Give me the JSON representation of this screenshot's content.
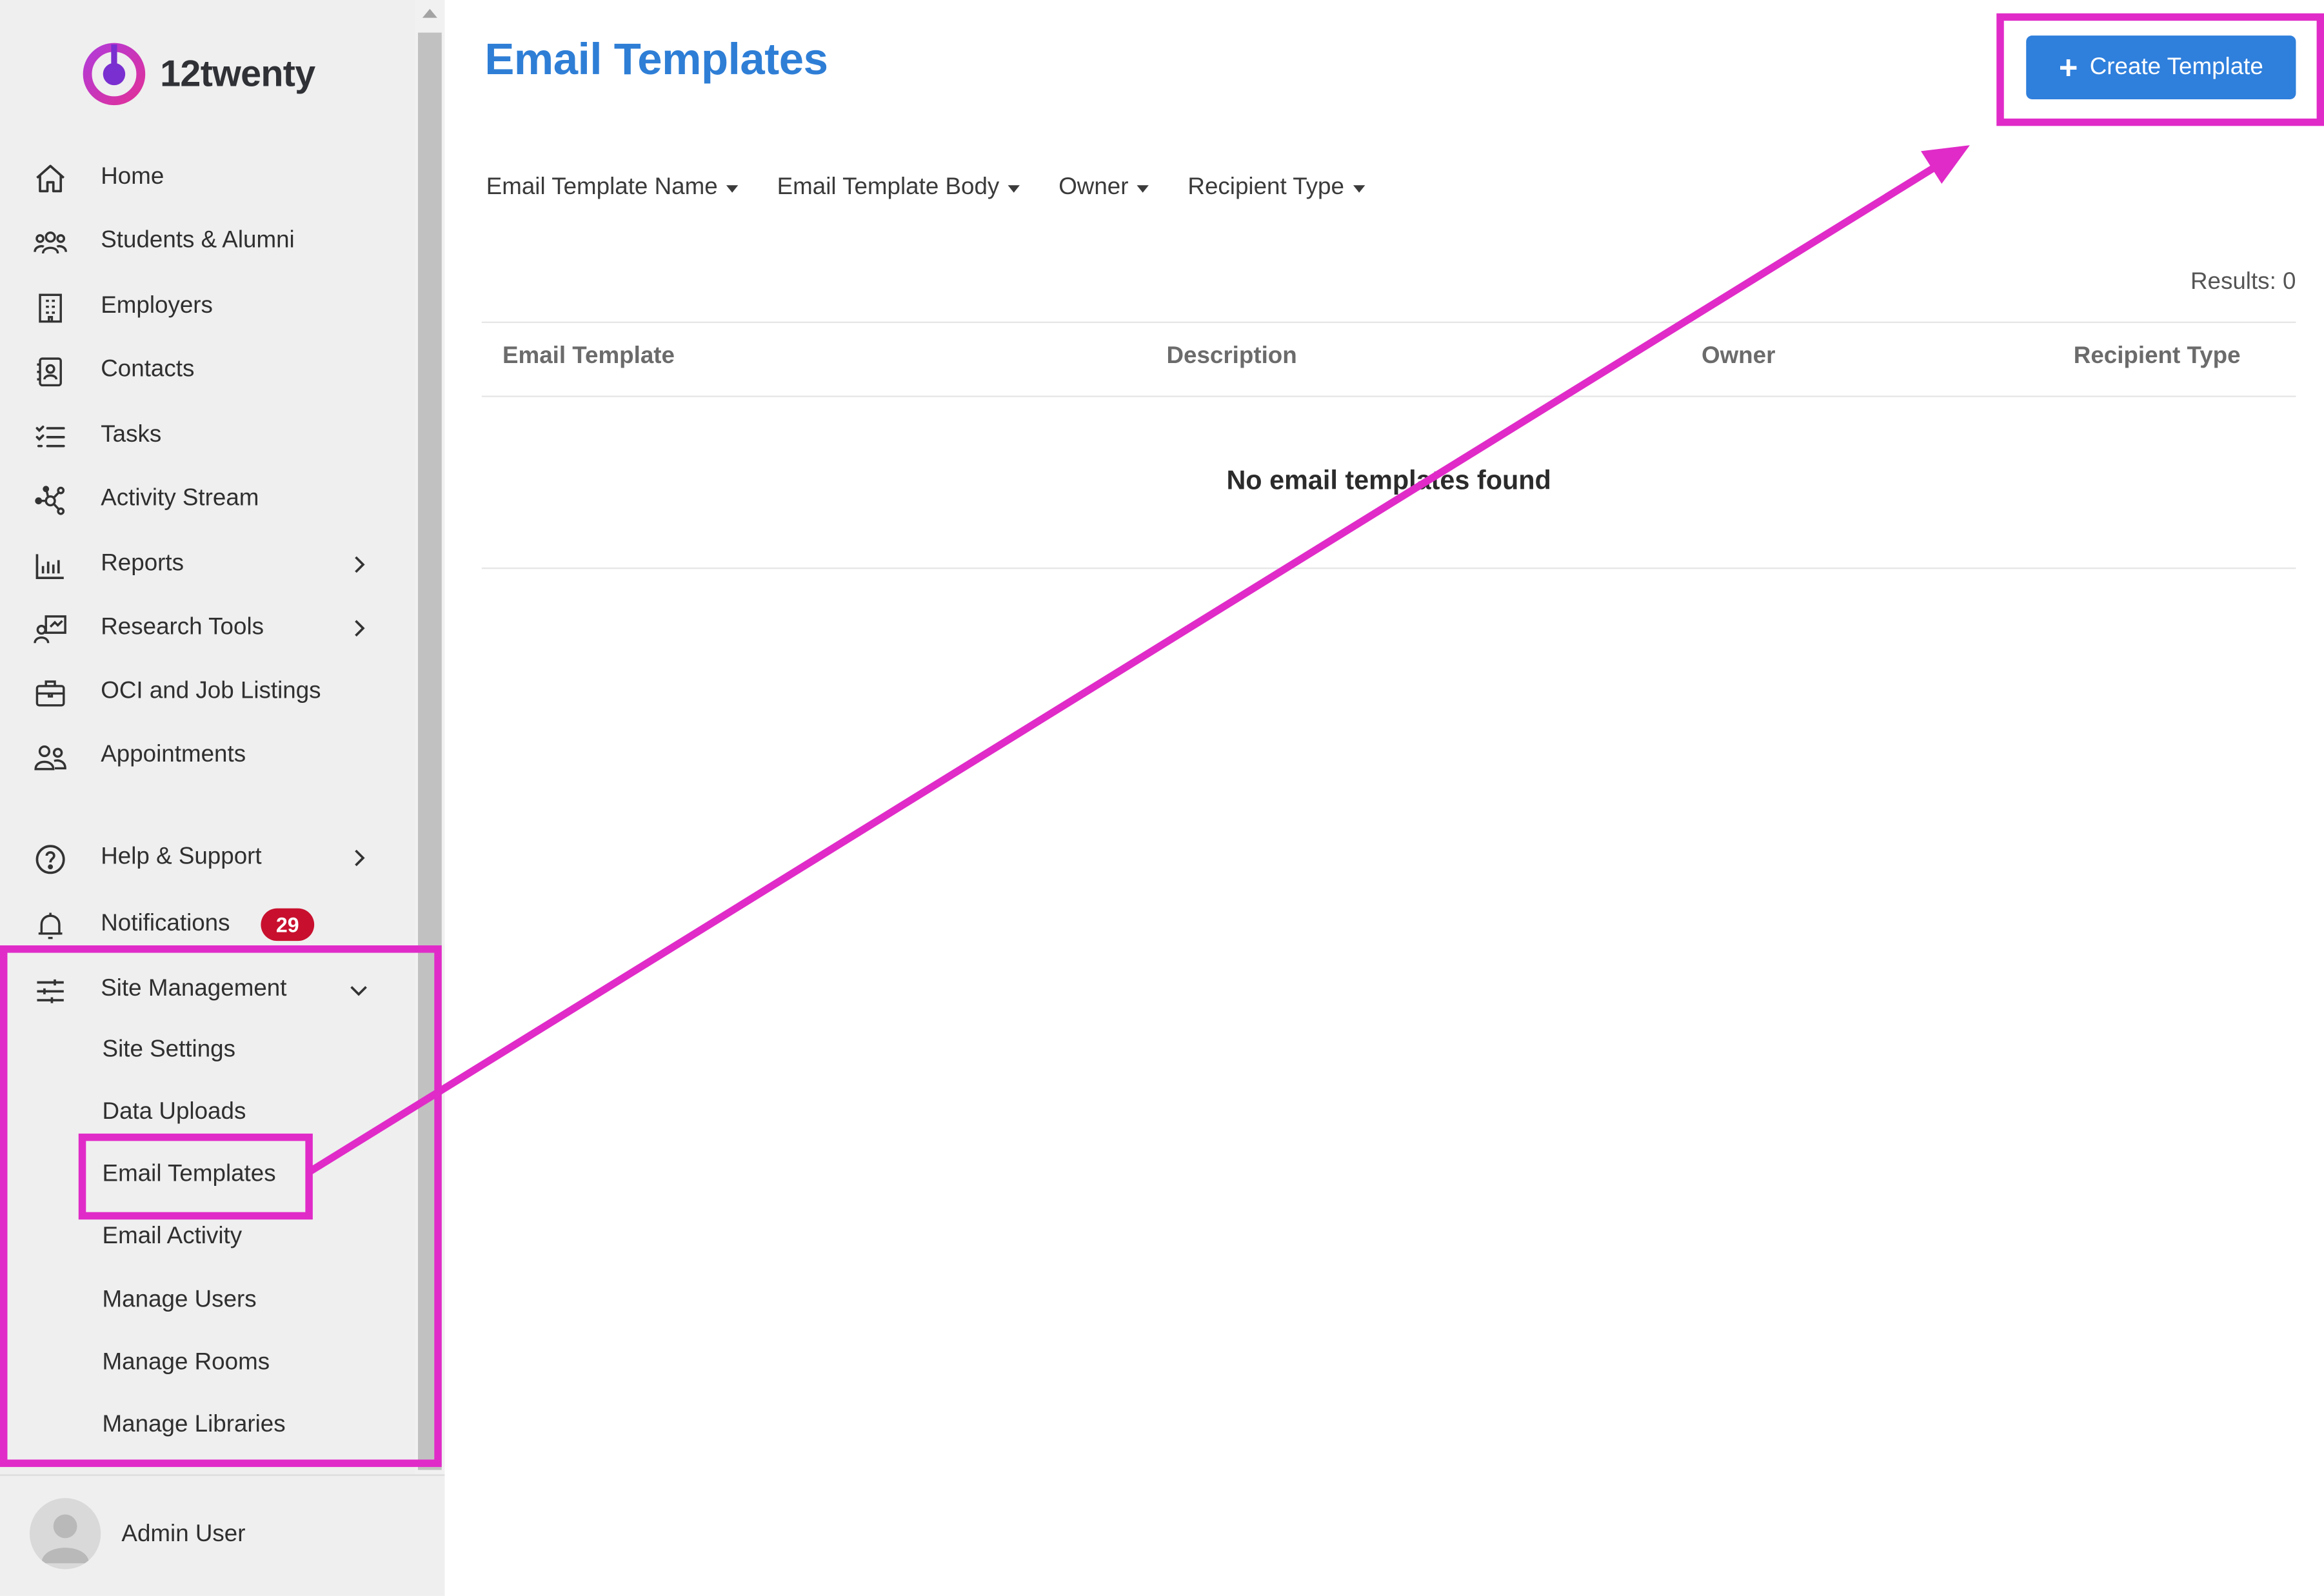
{
  "app": {
    "brand": "12twenty"
  },
  "colors": {
    "accent": "#2e7ed6",
    "button": "#2f7fdc",
    "badge": "#c8102e",
    "annotation": "#e02bc8"
  },
  "sidebar": {
    "items": [
      {
        "label": "Home",
        "icon": "home-icon"
      },
      {
        "label": "Students & Alumni",
        "icon": "people-group-icon"
      },
      {
        "label": "Employers",
        "icon": "building-icon"
      },
      {
        "label": "Contacts",
        "icon": "contact-card-icon"
      },
      {
        "label": "Tasks",
        "icon": "checklist-icon"
      },
      {
        "label": "Activity Stream",
        "icon": "network-icon"
      },
      {
        "label": "Reports",
        "icon": "bar-chart-icon"
      },
      {
        "label": "Research Tools",
        "icon": "research-icon"
      },
      {
        "label": "OCI and Job Listings",
        "icon": "briefcase-icon"
      },
      {
        "label": "Appointments",
        "icon": "two-people-icon"
      }
    ],
    "help": {
      "label": "Help & Support",
      "icon": "question-circle-icon"
    },
    "notifications": {
      "label": "Notifications",
      "icon": "bell-icon",
      "count": "29"
    },
    "site_management": {
      "label": "Site Management",
      "icon": "sliders-icon",
      "expanded": true,
      "subitems": [
        "Site Settings",
        "Data Uploads",
        "Email Templates",
        "Email Activity",
        "Manage Users",
        "Manage Rooms",
        "Manage Libraries"
      ],
      "active": "Email Templates"
    },
    "user": {
      "name": "Admin User"
    }
  },
  "main": {
    "title": "Email Templates",
    "create_button": "Create Template",
    "filters": [
      "Email Template Name",
      "Email Template Body",
      "Owner",
      "Recipient Type"
    ],
    "results": "Results: 0",
    "columns": [
      "Email Template",
      "Description",
      "Owner",
      "Recipient Type"
    ],
    "empty_message": "No email templates found"
  }
}
